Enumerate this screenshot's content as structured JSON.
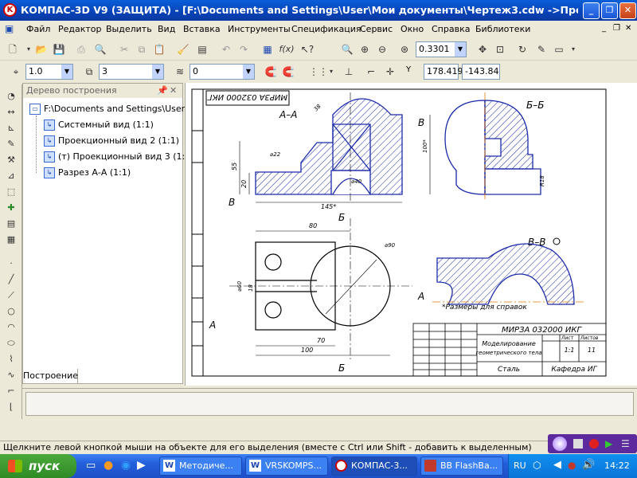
{
  "window": {
    "title": "КОМПАС-3D V9 (ЗАЩИТА) - [F:\\Documents and Settings\\User\\Мои документы\\Чертеж3.cdw ->Проекционный...",
    "app_icon_label": "K"
  },
  "menu": [
    "Файл",
    "Редактор",
    "Выделить",
    "Вид",
    "Вставка",
    "Инструменты",
    "Спецификация",
    "Сервис",
    "Окно",
    "Справка",
    "Библиотеки"
  ],
  "toolbar1": {
    "fx_label": "f(x)",
    "zoom_value": "0.3301"
  },
  "toolbar2": {
    "step_value": "1.0",
    "layer_value": "3",
    "style_value": "0",
    "coord_label": "Y",
    "coord_x": "178.419",
    "coord_y": "-143.84"
  },
  "tree": {
    "header": "Дерево построения",
    "root": "F:\\Documents and Settings\\User\\M",
    "items": [
      "Системный вид (1:1)",
      "Проекционный вид 2 (1:1)",
      "(т) Проекционный вид 3 (1:1",
      "Разрез А-А (1:1)"
    ],
    "tab": "Построение"
  },
  "drawing": {
    "stamp_rotated": "МИРЗА 032000 ИКГ",
    "section_aa": "А–А",
    "section_bb": "Б–Б",
    "section_vv": "В–В",
    "label_a": "А",
    "label_b": "Б",
    "label_v": "В",
    "dims": {
      "d145": "145*",
      "d55": "55",
      "d20": "20",
      "d22": "⌀22",
      "d40": "⌀40",
      "d60": "⌀60",
      "d100": "100*",
      "d70": "70",
      "d100b": "100",
      "d80": "80",
      "d90": "⌀90",
      "d18": "18",
      "d8": "R18",
      "d38": "38"
    },
    "note": "*Размеры для справок",
    "titleblock": {
      "code": "МИРЗА 032000 ИКГ",
      "name_line1": "Моделирование",
      "name_line2": "геометрического тела",
      "material": "Сталь",
      "org": "Кафедра ИГ",
      "sheet": "Лист",
      "sheets": "Листов",
      "scale": "1:1",
      "sheets_count": "11"
    }
  },
  "status": "Щелкните левой кнопкой мыши на объекте для его выделения (вместе с Ctrl или Shift - добавить к выделенным)",
  "taskbar": {
    "start": "пуск",
    "tasks": [
      "Методиче...",
      "VRSKOMPS...",
      "КОМПАС-3...",
      "BB FlashBa..."
    ],
    "lang": "RU",
    "time": "14:22"
  },
  "colors": {
    "title_blue": "#0842b7",
    "taskbar_blue": "#245edb",
    "start_green": "#2f8b24",
    "drawing_blue": "#1a2aa8",
    "axis_orange": "#e07a00"
  }
}
